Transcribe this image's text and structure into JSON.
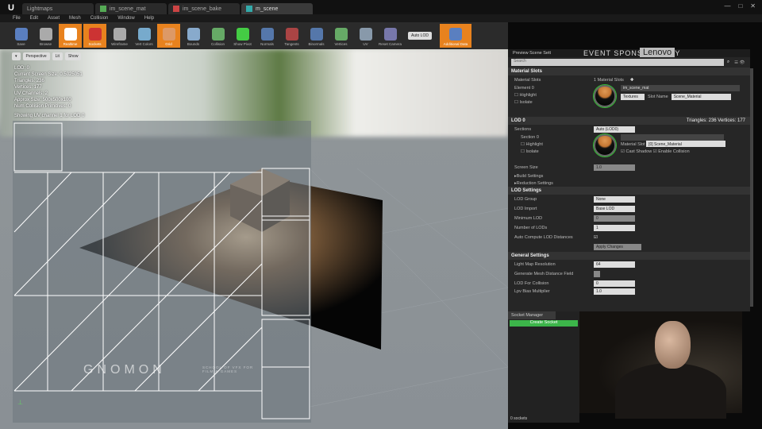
{
  "tabs": [
    {
      "label": "Lightmaps",
      "icon": "unreal-icon"
    },
    {
      "label": "im_scene_mat",
      "icon": "material-icon"
    },
    {
      "label": "im_scene_bake",
      "icon": "texture-icon"
    },
    {
      "label": "m_scene",
      "icon": "static-mesh-icon",
      "active": true
    }
  ],
  "menu": [
    "File",
    "Edit",
    "Asset",
    "Mesh",
    "Collision",
    "Window",
    "Help"
  ],
  "toolbar": [
    {
      "label": "Save",
      "color": "#5a7fc0"
    },
    {
      "label": "Browse",
      "color": "#aaa"
    },
    {
      "label": "Realtime",
      "on": true,
      "color": "#fff"
    },
    {
      "label": "Sockets",
      "on": true,
      "color": "#c33"
    },
    {
      "label": "Wireframe",
      "color": "#aaa"
    },
    {
      "label": "Vert Colors",
      "color": "#7ac"
    },
    {
      "label": "Grid",
      "on": true,
      "color": "#d96"
    },
    {
      "label": "Bounds",
      "color": "#8ac"
    },
    {
      "label": "Collision",
      "color": "#6a6"
    },
    {
      "label": "Show Pivot",
      "color": "#4c4"
    },
    {
      "label": "Normals",
      "color": "#57a"
    },
    {
      "label": "Tangents",
      "color": "#a44"
    },
    {
      "label": "Binormals",
      "color": "#57a"
    },
    {
      "label": "Vertices",
      "color": "#6a6"
    },
    {
      "label": "UV",
      "color": "#89a"
    },
    {
      "label": "Reset Camera",
      "color": "#77a"
    }
  ],
  "auto_lod": "Auto LOD",
  "additional_data": "Additional Data",
  "viewport": {
    "buttons": [
      "Perspective",
      "Lit",
      "Show"
    ],
    "stats": [
      "LOD: 0",
      "Current Screen Size: 0.5025051",
      "Triangles: 236",
      "Vertices: 177",
      "UV Channels: 2",
      "Approx Size: 500x500x100",
      "Num Collision Primitives: 0"
    ],
    "uv_label": "Showing UV channel 1 for LOD 0",
    "watermark": "GNOMON",
    "watermark_sub": "SCHOOL OF VFX FOR FILM & GAMES"
  },
  "panel": {
    "title": "Preview Scene Sett",
    "sponsor": "EVENT SPONSORED BY",
    "sponsor_brand": "Lenovo",
    "search_placeholder": "Search",
    "material_slots": {
      "title": "Material Slots",
      "label": "Material Slots",
      "count": "1 Material Slots",
      "element": "Element 0",
      "highlight": "Highlight",
      "isolate": "Isolate",
      "material": "im_scene_mat",
      "textures": "Textures",
      "slot_name_label": "Slot Name",
      "slot_name": "Scene_Material"
    },
    "lod0": {
      "title": "LOD 0",
      "stats": "Triangles: 236   Vertices: 177",
      "sections": "Sections",
      "sections_value": "Auto (LOD0)",
      "section0": "Section 0",
      "highlight": "Highlight",
      "isolate": "Isolate",
      "material_slot_label": "Material Slot",
      "material_slot": "[0] Scene_Material",
      "cast_shadow": "Cast Shadow",
      "enable_collision": "Enable Collision",
      "screen_size": "Screen Size",
      "screen_size_value": "1.0",
      "build_settings": "Build Settings",
      "reduction_settings": "Reduction Settings"
    },
    "lod_settings": {
      "title": "LOD Settings",
      "rows": [
        {
          "label": "LOD Group",
          "value": "None"
        },
        {
          "label": "LOD Import",
          "value": "Base LOD"
        },
        {
          "label": "Minimum LOD",
          "value": "0"
        },
        {
          "label": "Number of LODs",
          "value": "1"
        }
      ],
      "auto_compute": "Auto Compute LOD Distances",
      "apply": "Apply Changes"
    },
    "general": {
      "title": "General Settings",
      "rows": [
        {
          "label": "Light Map Resolution",
          "value": "64"
        },
        {
          "label": "Generate Mesh Distance Field",
          "value": ""
        },
        {
          "label": "LOD For Collision",
          "value": "0"
        },
        {
          "label": "Lpv Bias Multiplier",
          "value": "1.0"
        }
      ]
    }
  },
  "sockets": {
    "tab": "Socket Manager",
    "create": "Create Socket",
    "count": "0 sockets"
  }
}
